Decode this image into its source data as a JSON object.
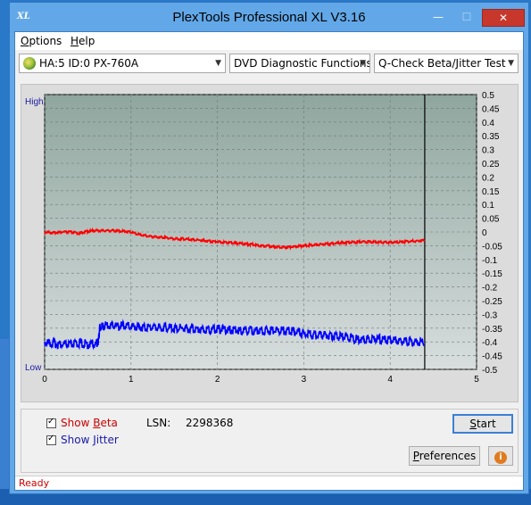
{
  "window": {
    "title": "PlexTools Professional XL V3.16",
    "app_icon_text": "XL",
    "controls": {
      "minimize": "—",
      "maximize": "☐",
      "close": "✕"
    }
  },
  "menu": {
    "options": {
      "accel": "O",
      "rest": "ptions"
    },
    "help": {
      "accel": "H",
      "rest": "elp"
    }
  },
  "toolbar": {
    "drive": "HA:5 ID:0  PX-760A",
    "function": "DVD Diagnostic Functions",
    "test": "Q-Check Beta/Jitter Test",
    "dropdown_icon": "chevron-down-icon"
  },
  "chart_data": {
    "type": "line",
    "left_axis_labels": {
      "top": "High",
      "bottom": "Low"
    },
    "x_ticks": [
      "0",
      "1",
      "2",
      "3",
      "4",
      "5"
    ],
    "xlim": [
      0,
      5
    ],
    "y_ticks": [
      "0.5",
      "0.45",
      "0.4",
      "0.35",
      "0.3",
      "0.25",
      "0.2",
      "0.15",
      "0.1",
      "0.05",
      "0",
      "-0.05",
      "-0.1",
      "-0.15",
      "-0.2",
      "-0.25",
      "-0.3",
      "-0.35",
      "-0.4",
      "-0.45",
      "-0.5"
    ],
    "ylim": [
      -0.5,
      0.5
    ],
    "end_marker_x": 4.4,
    "grid": true,
    "series": [
      {
        "color": "#ff0000",
        "x": [
          0,
          0.1,
          0.2,
          0.3,
          0.4,
          0.5,
          0.6,
          0.7,
          0.8,
          0.9,
          1.0,
          1.1,
          1.2,
          1.3,
          1.4,
          1.5,
          1.6,
          1.7,
          1.8,
          1.9,
          2.0,
          2.1,
          2.2,
          2.3,
          2.4,
          2.5,
          2.6,
          2.7,
          2.8,
          2.9,
          3.0,
          3.1,
          3.2,
          3.3,
          3.4,
          3.5,
          3.6,
          3.7,
          3.8,
          3.9,
          4.0,
          4.1,
          4.2,
          4.3,
          4.4
        ],
        "values": [
          0.0,
          -0.003,
          0.0,
          0.0,
          -0.005,
          0.003,
          0.005,
          0.005,
          0.005,
          0.003,
          0.0,
          -0.01,
          -0.015,
          -0.018,
          -0.02,
          -0.025,
          -0.025,
          -0.028,
          -0.03,
          -0.033,
          -0.035,
          -0.038,
          -0.04,
          -0.043,
          -0.045,
          -0.05,
          -0.052,
          -0.055,
          -0.055,
          -0.053,
          -0.05,
          -0.048,
          -0.045,
          -0.043,
          -0.04,
          -0.038,
          -0.037,
          -0.036,
          -0.036,
          -0.037,
          -0.038,
          -0.037,
          -0.035,
          -0.033,
          -0.03
        ]
      },
      {
        "color": "#0000ff",
        "x": [
          0,
          0.1,
          0.2,
          0.3,
          0.4,
          0.5,
          0.6,
          0.62,
          0.64,
          0.7,
          0.8,
          0.9,
          1.0,
          1.1,
          1.2,
          1.3,
          1.4,
          1.5,
          1.6,
          1.7,
          1.8,
          1.9,
          2.0,
          2.1,
          2.2,
          2.3,
          2.4,
          2.5,
          2.6,
          2.7,
          2.8,
          2.9,
          3.0,
          3.1,
          3.2,
          3.3,
          3.4,
          3.5,
          3.6,
          3.7,
          3.8,
          3.9,
          4.0,
          4.1,
          4.2,
          4.3,
          4.4
        ],
        "values": [
          -0.4,
          -0.405,
          -0.41,
          -0.41,
          -0.405,
          -0.41,
          -0.405,
          -0.4,
          -0.345,
          -0.34,
          -0.34,
          -0.342,
          -0.343,
          -0.345,
          -0.345,
          -0.347,
          -0.348,
          -0.35,
          -0.35,
          -0.352,
          -0.353,
          -0.355,
          -0.355,
          -0.355,
          -0.357,
          -0.358,
          -0.36,
          -0.36,
          -0.358,
          -0.357,
          -0.36,
          -0.362,
          -0.37,
          -0.375,
          -0.375,
          -0.378,
          -0.38,
          -0.385,
          -0.39,
          -0.39,
          -0.39,
          -0.392,
          -0.395,
          -0.395,
          -0.398,
          -0.4,
          -0.4
        ]
      }
    ]
  },
  "controls": {
    "show_beta": {
      "before": "Show ",
      "accel": "B",
      "after": "eta",
      "color": "#cc0000",
      "checked": true
    },
    "show_jitter": {
      "before": "Show ",
      "accel": "J",
      "after": "itter",
      "color": "#1a1aa6",
      "checked": true
    },
    "lsn_label": "LSN:",
    "lsn_value": "2298368",
    "start": {
      "accel": "S",
      "rest": "tart"
    },
    "preferences": {
      "accel": "P",
      "rest": "references"
    },
    "info_icon": "info-icon",
    "info_symbol": "i"
  },
  "status": {
    "text": "Ready"
  },
  "colors": {
    "plot_bg_top": "#8fa69e",
    "plot_bg_bottom": "#d8dede",
    "grid": "#6c7a76",
    "axis_label_blue": "#1a1aa6"
  }
}
